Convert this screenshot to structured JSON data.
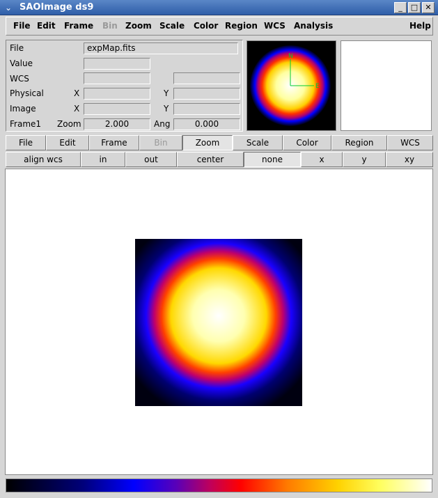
{
  "window": {
    "title": "SAOImage ds9"
  },
  "menubar": [
    "File",
    "Edit",
    "Frame",
    "Bin",
    "Zoom",
    "Scale",
    "Color",
    "Region",
    "WCS",
    "Analysis",
    "Help"
  ],
  "info": {
    "file_label": "File",
    "file_value": "expMap.fits",
    "value_label": "Value",
    "value": "",
    "wcs_label": "WCS",
    "wcs_value": "",
    "wcs_value2": "",
    "physical_label": "Physical",
    "physical_x_label": "X",
    "physical_y_label": "Y",
    "physical_x": "",
    "physical_y": "",
    "image_label": "Image",
    "image_x_label": "X",
    "image_y_label": "Y",
    "image_x": "",
    "image_y": "",
    "frame_label": "Frame1",
    "zoom_label": "Zoom",
    "zoom_value": "2.000",
    "ang_label": "Ang",
    "ang_value": "0.000"
  },
  "panner": {
    "north": "N",
    "east": "E"
  },
  "buttonbar1": [
    "File",
    "Edit",
    "Frame",
    "Bin",
    "Zoom",
    "Scale",
    "Color",
    "Region",
    "WCS"
  ],
  "buttonbar2": [
    "align wcs",
    "in",
    "out",
    "center",
    "none",
    "x",
    "y",
    "xy"
  ],
  "colors": {
    "accent": "#2f5ea8",
    "panel": "#d6d6d6"
  }
}
